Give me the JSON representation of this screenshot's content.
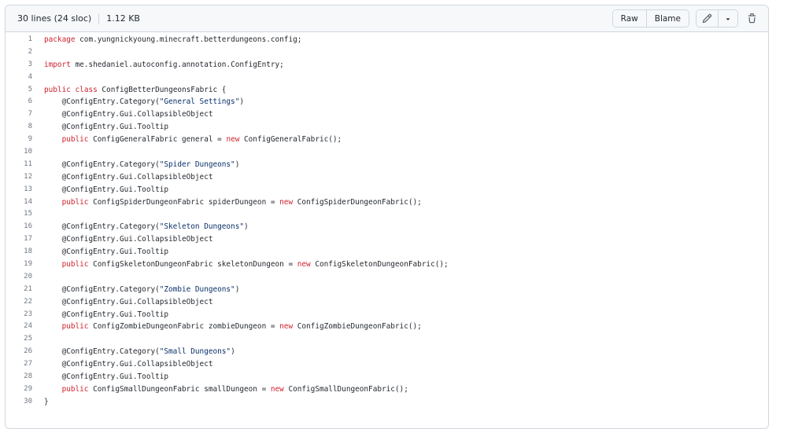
{
  "file_info": {
    "lines": "30 lines (24 sloc)",
    "size": "1.12 KB"
  },
  "toolbar": {
    "raw_label": "Raw",
    "blame_label": "Blame"
  },
  "icons": {
    "edit": "pencil-icon",
    "dropdown": "triangle-down-icon",
    "delete": "trash-icon"
  },
  "colors": {
    "keyword": "#cf222e",
    "string": "#0a3069",
    "line_number": "#6e7781",
    "text": "#24292f"
  },
  "code_lines": [
    {
      "n": "1",
      "tokens": [
        {
          "t": "package",
          "c": "kw"
        },
        {
          "t": " com.yungnickyoung.minecraft.betterdungeons.config;"
        }
      ]
    },
    {
      "n": "2",
      "tokens": []
    },
    {
      "n": "3",
      "tokens": [
        {
          "t": "import",
          "c": "kw"
        },
        {
          "t": " me.shedaniel.autoconfig.annotation.ConfigEntry;"
        }
      ]
    },
    {
      "n": "4",
      "tokens": []
    },
    {
      "n": "5",
      "tokens": [
        {
          "t": "public",
          "c": "kw"
        },
        {
          "t": " "
        },
        {
          "t": "class",
          "c": "kw"
        },
        {
          "t": " ConfigBetterDungeonsFabric {"
        }
      ]
    },
    {
      "n": "6",
      "tokens": [
        {
          "t": "    @ConfigEntry.Category("
        },
        {
          "t": "\"General Settings\"",
          "c": "str"
        },
        {
          "t": ")"
        }
      ]
    },
    {
      "n": "7",
      "tokens": [
        {
          "t": "    @ConfigEntry.Gui.CollapsibleObject"
        }
      ]
    },
    {
      "n": "8",
      "tokens": [
        {
          "t": "    @ConfigEntry.Gui.Tooltip"
        }
      ]
    },
    {
      "n": "9",
      "tokens": [
        {
          "t": "    "
        },
        {
          "t": "public",
          "c": "kw"
        },
        {
          "t": " ConfigGeneralFabric general = "
        },
        {
          "t": "new",
          "c": "kw"
        },
        {
          "t": " ConfigGeneralFabric();"
        }
      ]
    },
    {
      "n": "10",
      "tokens": []
    },
    {
      "n": "11",
      "tokens": [
        {
          "t": "    @ConfigEntry.Category("
        },
        {
          "t": "\"Spider Dungeons\"",
          "c": "str"
        },
        {
          "t": ")"
        }
      ]
    },
    {
      "n": "12",
      "tokens": [
        {
          "t": "    @ConfigEntry.Gui.CollapsibleObject"
        }
      ]
    },
    {
      "n": "13",
      "tokens": [
        {
          "t": "    @ConfigEntry.Gui.Tooltip"
        }
      ]
    },
    {
      "n": "14",
      "tokens": [
        {
          "t": "    "
        },
        {
          "t": "public",
          "c": "kw"
        },
        {
          "t": " ConfigSpiderDungeonFabric spiderDungeon = "
        },
        {
          "t": "new",
          "c": "kw"
        },
        {
          "t": " ConfigSpiderDungeonFabric();"
        }
      ]
    },
    {
      "n": "15",
      "tokens": []
    },
    {
      "n": "16",
      "tokens": [
        {
          "t": "    @ConfigEntry.Category("
        },
        {
          "t": "\"Skeleton Dungeons\"",
          "c": "str"
        },
        {
          "t": ")"
        }
      ]
    },
    {
      "n": "17",
      "tokens": [
        {
          "t": "    @ConfigEntry.Gui.CollapsibleObject"
        }
      ]
    },
    {
      "n": "18",
      "tokens": [
        {
          "t": "    @ConfigEntry.Gui.Tooltip"
        }
      ]
    },
    {
      "n": "19",
      "tokens": [
        {
          "t": "    "
        },
        {
          "t": "public",
          "c": "kw"
        },
        {
          "t": " ConfigSkeletonDungeonFabric skeletonDungeon = "
        },
        {
          "t": "new",
          "c": "kw"
        },
        {
          "t": " ConfigSkeletonDungeonFabric();"
        }
      ]
    },
    {
      "n": "20",
      "tokens": []
    },
    {
      "n": "21",
      "tokens": [
        {
          "t": "    @ConfigEntry.Category("
        },
        {
          "t": "\"Zombie Dungeons\"",
          "c": "str"
        },
        {
          "t": ")"
        }
      ]
    },
    {
      "n": "22",
      "tokens": [
        {
          "t": "    @ConfigEntry.Gui.CollapsibleObject"
        }
      ]
    },
    {
      "n": "23",
      "tokens": [
        {
          "t": "    @ConfigEntry.Gui.Tooltip"
        }
      ]
    },
    {
      "n": "24",
      "tokens": [
        {
          "t": "    "
        },
        {
          "t": "public",
          "c": "kw"
        },
        {
          "t": " ConfigZombieDungeonFabric zombieDungeon = "
        },
        {
          "t": "new",
          "c": "kw"
        },
        {
          "t": " ConfigZombieDungeonFabric();"
        }
      ]
    },
    {
      "n": "25",
      "tokens": []
    },
    {
      "n": "26",
      "tokens": [
        {
          "t": "    @ConfigEntry.Category("
        },
        {
          "t": "\"Small Dungeons\"",
          "c": "str"
        },
        {
          "t": ")"
        }
      ]
    },
    {
      "n": "27",
      "tokens": [
        {
          "t": "    @ConfigEntry.Gui.CollapsibleObject"
        }
      ]
    },
    {
      "n": "28",
      "tokens": [
        {
          "t": "    @ConfigEntry.Gui.Tooltip"
        }
      ]
    },
    {
      "n": "29",
      "tokens": [
        {
          "t": "    "
        },
        {
          "t": "public",
          "c": "kw"
        },
        {
          "t": " ConfigSmallDungeonFabric smallDungeon = "
        },
        {
          "t": "new",
          "c": "kw"
        },
        {
          "t": " ConfigSmallDungeonFabric();"
        }
      ]
    },
    {
      "n": "30",
      "tokens": [
        {
          "t": "}"
        }
      ]
    }
  ]
}
